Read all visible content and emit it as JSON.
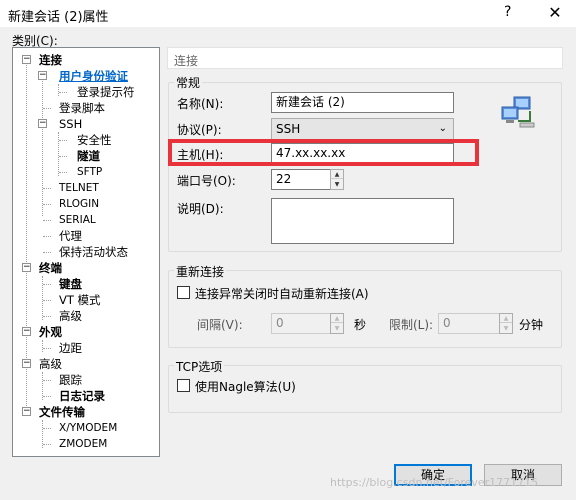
{
  "window": {
    "title": "新建会话 (2)属性",
    "help_glyph": "?",
    "close_glyph": "✕"
  },
  "category_label": "类别(C):",
  "tree": {
    "items": [
      {
        "label": "连接",
        "bold": true
      },
      {
        "label": "用户身份验证",
        "bold": true,
        "selected": true
      },
      {
        "label": "登录提示符"
      },
      {
        "label": "登录脚本"
      },
      {
        "label": "SSH"
      },
      {
        "label": "安全性"
      },
      {
        "label": "隧道",
        "bold": true
      },
      {
        "label": "SFTP"
      },
      {
        "label": "TELNET"
      },
      {
        "label": "RLOGIN"
      },
      {
        "label": "SERIAL"
      },
      {
        "label": "代理"
      },
      {
        "label": "保持活动状态"
      },
      {
        "label": "终端",
        "bold": true
      },
      {
        "label": "键盘",
        "bold": true
      },
      {
        "label": "VT 模式"
      },
      {
        "label": "高级"
      },
      {
        "label": "外观",
        "bold": true
      },
      {
        "label": "边距"
      },
      {
        "label": "高级"
      },
      {
        "label": "跟踪"
      },
      {
        "label": "日志记录",
        "bold": true
      },
      {
        "label": "文件传输",
        "bold": true
      },
      {
        "label": "X/YMODEM"
      },
      {
        "label": "ZMODEM"
      }
    ]
  },
  "panel": {
    "header": "连接",
    "general": {
      "legend": "常规",
      "name_label": "名称(N):",
      "name_value": "新建会话 (2)",
      "protocol_label": "协议(P):",
      "protocol_value": "SSH",
      "host_label": "主机(H):",
      "host_value": "47.xx.xx.xx",
      "port_label": "端口号(O):",
      "port_value": "22",
      "desc_label": "说明(D):",
      "desc_value": ""
    },
    "reconnect": {
      "legend": "重新连接",
      "checkbox_label": "连接异常关闭时自动重新连接(A)",
      "checked": false,
      "interval_label": "间隔(V):",
      "interval_value": "0",
      "sec_unit": "秒",
      "limit_label": "限制(L):",
      "limit_value": "0",
      "min_unit": "分钟"
    },
    "tcp": {
      "legend": "TCP选项",
      "nagle_label": "使用Nagle算法(U)",
      "checked": false
    }
  },
  "buttons": {
    "ok": "确定",
    "cancel": "取消"
  },
  "watermark": "https://blog.csdn.net/Forever1771715",
  "colors": {
    "highlight": "#e8323c",
    "selected_link": "#0066cc",
    "primary_border": "#0078d7"
  }
}
